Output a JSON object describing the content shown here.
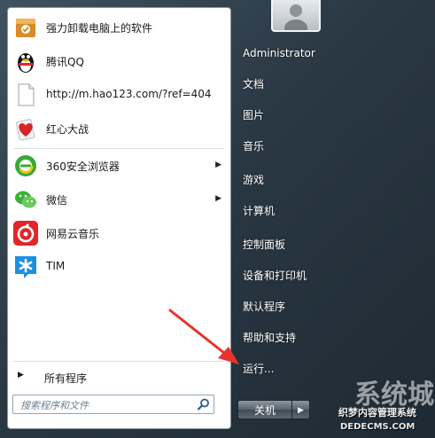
{
  "programs": [
    {
      "label": "强力卸载电脑上的软件",
      "icon": "uninstaller-icon",
      "has_submenu": false
    },
    {
      "label": "腾讯QQ",
      "icon": "qq-penguin-icon",
      "has_submenu": false
    },
    {
      "label": "http://m.hao123.com/?ref=404",
      "icon": "document-icon",
      "has_submenu": false
    },
    {
      "label": "红心大战",
      "icon": "hearts-game-icon",
      "has_submenu": false
    },
    {
      "label": "360安全浏览器",
      "icon": "browser-360-icon",
      "has_submenu": true
    },
    {
      "label": "微信",
      "icon": "wechat-icon",
      "has_submenu": true
    },
    {
      "label": "网易云音乐",
      "icon": "netease-music-icon",
      "has_submenu": false
    },
    {
      "label": "TIM",
      "icon": "tim-icon",
      "has_submenu": false
    }
  ],
  "all_programs": "所有程序",
  "search": {
    "placeholder": "搜索程序和文件"
  },
  "right_pane": {
    "user": "Administrator",
    "items": [
      "文档",
      "图片",
      "音乐",
      "游戏",
      "计算机",
      "控制面板",
      "设备和打印机",
      "默认程序",
      "帮助和支持",
      "运行..."
    ]
  },
  "shutdown_label": "关机",
  "watermark": {
    "line1": "织梦内容管理系统",
    "line2": "DEDECMS.COM",
    "bg": "系统城"
  },
  "colors": {
    "arrow": "#e8322d",
    "frame": "#2a3844"
  }
}
